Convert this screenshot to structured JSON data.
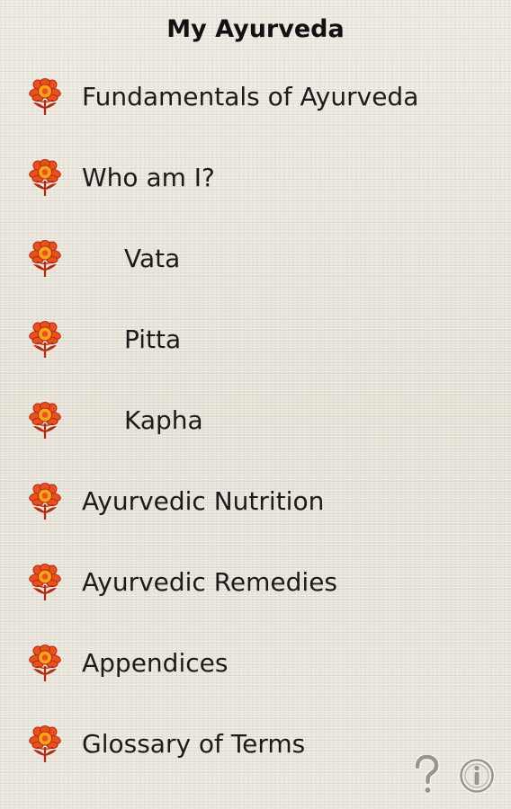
{
  "header": {
    "title": "My Ayurveda"
  },
  "colors": {
    "flower_petal": "#e8501e",
    "flower_edge": "#b22a12",
    "flower_center": "#f6a21a",
    "icon_gray": "#9a958c"
  },
  "menu": {
    "item_icon": "lotus-flower-icon",
    "items": [
      {
        "label": "Fundamentals of Ayurveda",
        "indented": false
      },
      {
        "label": "Who am I?",
        "indented": false
      },
      {
        "label": "Vata",
        "indented": true
      },
      {
        "label": "Pitta",
        "indented": true
      },
      {
        "label": "Kapha",
        "indented": true
      },
      {
        "label": "Ayurvedic Nutrition",
        "indented": false
      },
      {
        "label": "Ayurvedic Remedies",
        "indented": false
      },
      {
        "label": "Appendices",
        "indented": false
      },
      {
        "label": "Glossary of Terms",
        "indented": false
      }
    ]
  },
  "footer": {
    "help_icon": "question-mark-icon",
    "info_icon": "info-circle-icon"
  }
}
